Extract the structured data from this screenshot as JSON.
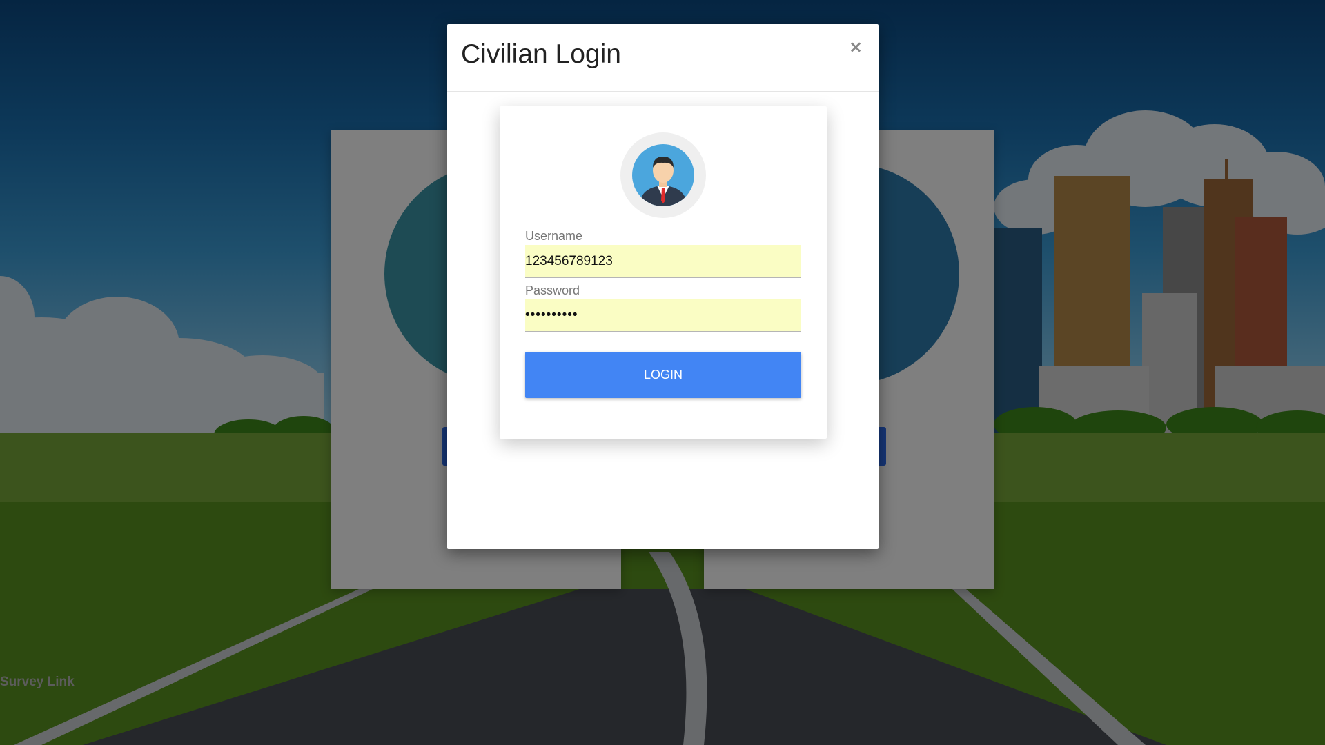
{
  "modal": {
    "title": "Civilian Login",
    "close_symbol": "×",
    "username_label": "Username",
    "username_value": "123456789123",
    "password_label": "Password",
    "password_value": "••••••••••",
    "login_button": "LOGIN"
  },
  "page": {
    "survey_link": "Survey Link"
  },
  "icons": {
    "avatar": "businessman-avatar-icon",
    "close": "close-icon"
  },
  "colors": {
    "login_button": "#4285f4",
    "input_autofill_bg": "#fafdc4",
    "role_button": "#2f6ff0"
  }
}
